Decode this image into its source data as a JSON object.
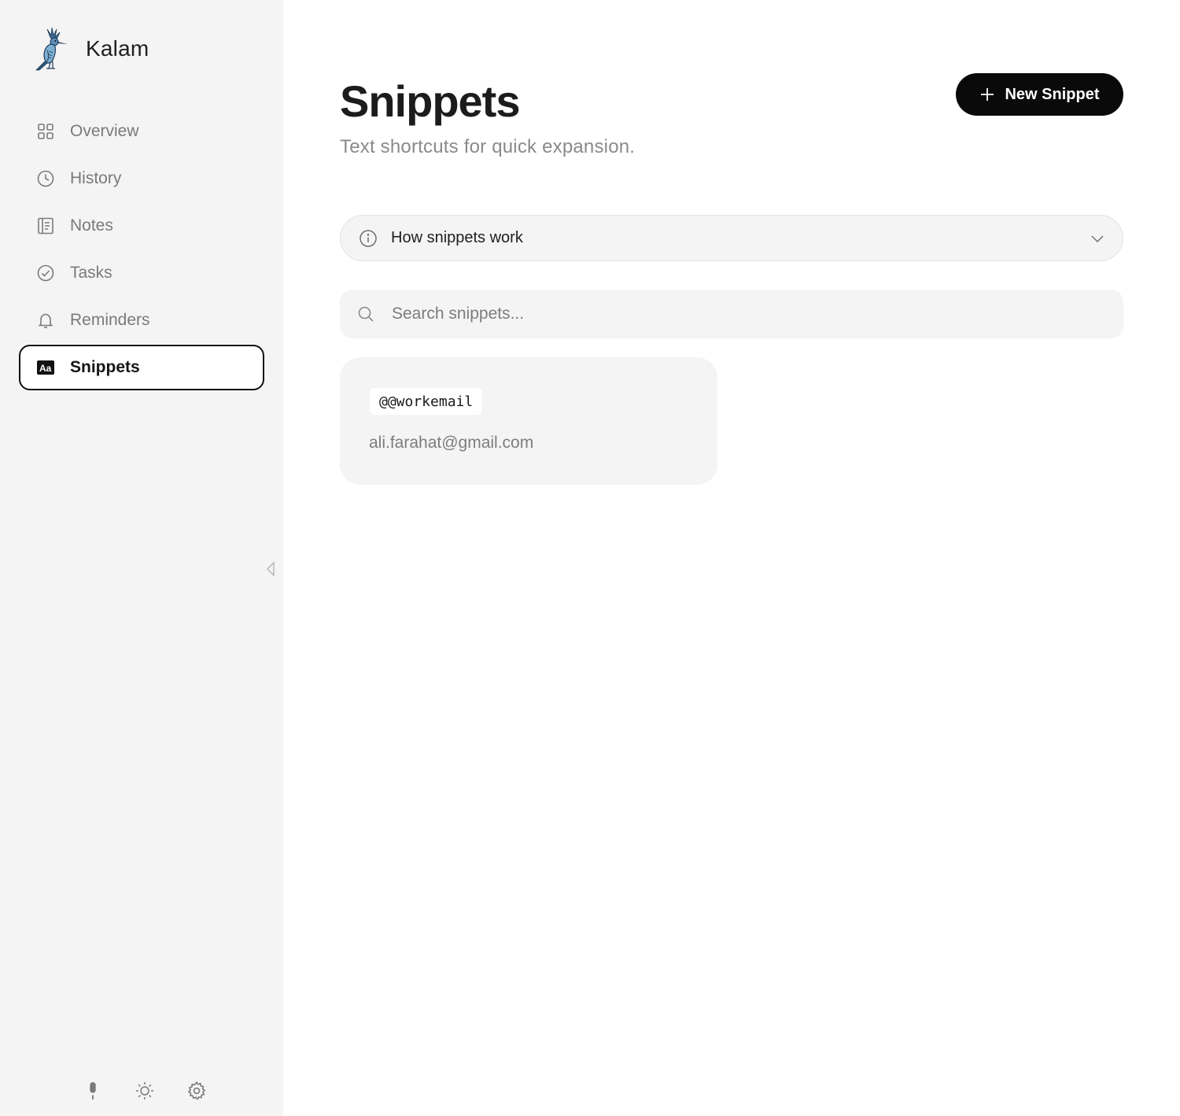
{
  "app": {
    "name": "Kalam"
  },
  "sidebar": {
    "items": [
      {
        "label": "Overview",
        "icon": "grid-icon"
      },
      {
        "label": "History",
        "icon": "clock-icon"
      },
      {
        "label": "Notes",
        "icon": "notes-icon"
      },
      {
        "label": "Tasks",
        "icon": "check-circle-icon"
      },
      {
        "label": "Reminders",
        "icon": "bell-icon"
      },
      {
        "label": "Snippets",
        "icon": "text-aa-icon",
        "active": true
      }
    ],
    "footer": [
      "microphone-icon",
      "sun-icon",
      "gear-icon"
    ]
  },
  "main": {
    "title": "Snippets",
    "subtitle": "Text shortcuts for quick expansion.",
    "new_button_label": "New Snippet",
    "how_it_works": "How snippets work",
    "search": {
      "placeholder": "Search snippets...",
      "value": ""
    },
    "snippets": [
      {
        "trigger": "@@workemail",
        "expansion": "ali.farahat@gmail.com"
      }
    ]
  },
  "colors": {
    "sidebar_bg": "#f4f4f5",
    "accent": "#0a0a0a",
    "muted_text": "#7a7a7a",
    "panel_bg": "#f4f4f5"
  }
}
